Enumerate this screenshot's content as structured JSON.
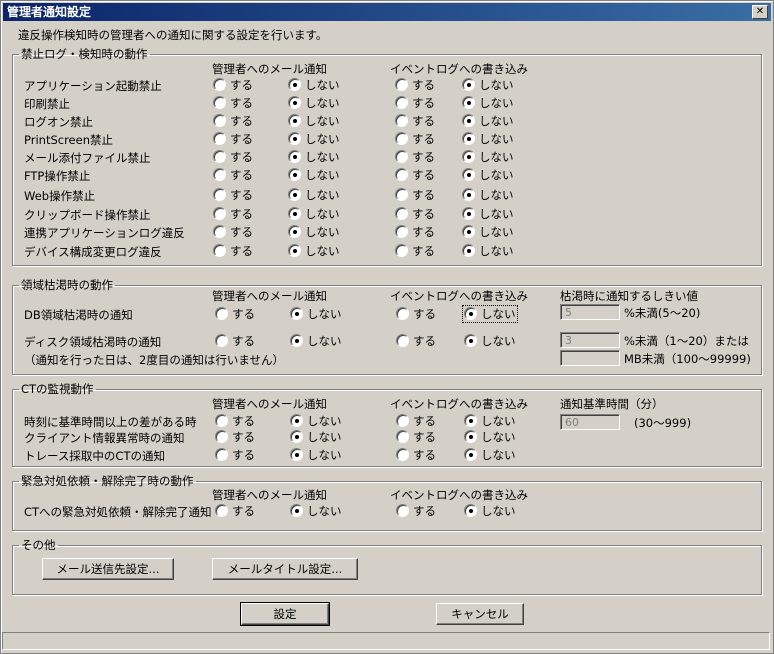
{
  "window": {
    "title": "管理者通知設定",
    "close_label": "✕"
  },
  "intro": "違反操作検知時の管理者への通知に関する設定を行います。",
  "radio_on": "する",
  "radio_off": "しない",
  "section1": {
    "legend": "禁止ログ・検知時の動作",
    "col_mail": "管理者へのメール通知",
    "col_event": "イベントログへの書き込み",
    "rows": [
      {
        "label": "アプリケーション起動禁止",
        "mail": "off",
        "event": "off"
      },
      {
        "label": "印刷禁止",
        "mail": "off",
        "event": "off"
      },
      {
        "label": "ログオン禁止",
        "mail": "off",
        "event": "off"
      },
      {
        "label": "PrintScreen禁止",
        "mail": "off",
        "event": "off"
      },
      {
        "label": "メール添付ファイル禁止",
        "mail": "off",
        "event": "off"
      },
      {
        "label": "FTP操作禁止",
        "mail": "off",
        "event": "off"
      },
      {
        "label": "Web操作禁止",
        "mail": "off",
        "event": "off"
      },
      {
        "label": "クリップボード操作禁止",
        "mail": "off",
        "event": "off"
      },
      {
        "label": "連携アプリケーションログ違反",
        "mail": "off",
        "event": "off"
      },
      {
        "label": "デバイス構成変更ログ違反",
        "mail": "off",
        "event": "off"
      }
    ]
  },
  "section2": {
    "legend": "領域枯渇時の動作",
    "col_mail": "管理者へのメール通知",
    "col_event": "イベントログへの書き込み",
    "col_threshold": "枯渇時に通知するしきい値",
    "rows": [
      {
        "label": "DB領域枯渇時の通知",
        "mail": "off",
        "event": "off"
      },
      {
        "label": "ディスク領域枯渇時の通知",
        "mail": "off",
        "event": "off"
      }
    ],
    "note": "（通知を行った日は、2度目の通知は行いません）",
    "db_threshold": "5",
    "db_unit": "%未満(5～20)",
    "disk_threshold": "3",
    "disk_unit": "%未満（1～20）または",
    "disk_mb_threshold": "",
    "disk_mb_unit": "MB未満（100～99999)"
  },
  "section3": {
    "legend": "CTの監視動作",
    "col_mail": "管理者へのメール通知",
    "col_event": "イベントログへの書き込み",
    "col_time": "通知基準時間（分）",
    "rows": [
      {
        "label": "時刻に基準時間以上の差がある時",
        "mail": "off",
        "event": "off"
      },
      {
        "label": "クライアント情報異常時の通知",
        "mail": "off",
        "event": "off"
      },
      {
        "label": "トレース採取中のCTの通知",
        "mail": "off",
        "event": "off"
      }
    ],
    "time_value": "60",
    "time_range": "(30～999)"
  },
  "section4": {
    "legend": "緊急対処依頼・解除完了時の動作",
    "col_mail": "管理者へのメール通知",
    "col_event": "イベントログへの書き込み",
    "rows": [
      {
        "label": "CTへの緊急対処依頼・解除完了通知",
        "mail": "off",
        "event": "off"
      }
    ]
  },
  "section5": {
    "legend": "その他",
    "mail_dest_button": "メール送信先設定...",
    "mail_title_button": "メールタイトル設定..."
  },
  "buttons": {
    "ok": "設定",
    "cancel": "キャンセル"
  }
}
